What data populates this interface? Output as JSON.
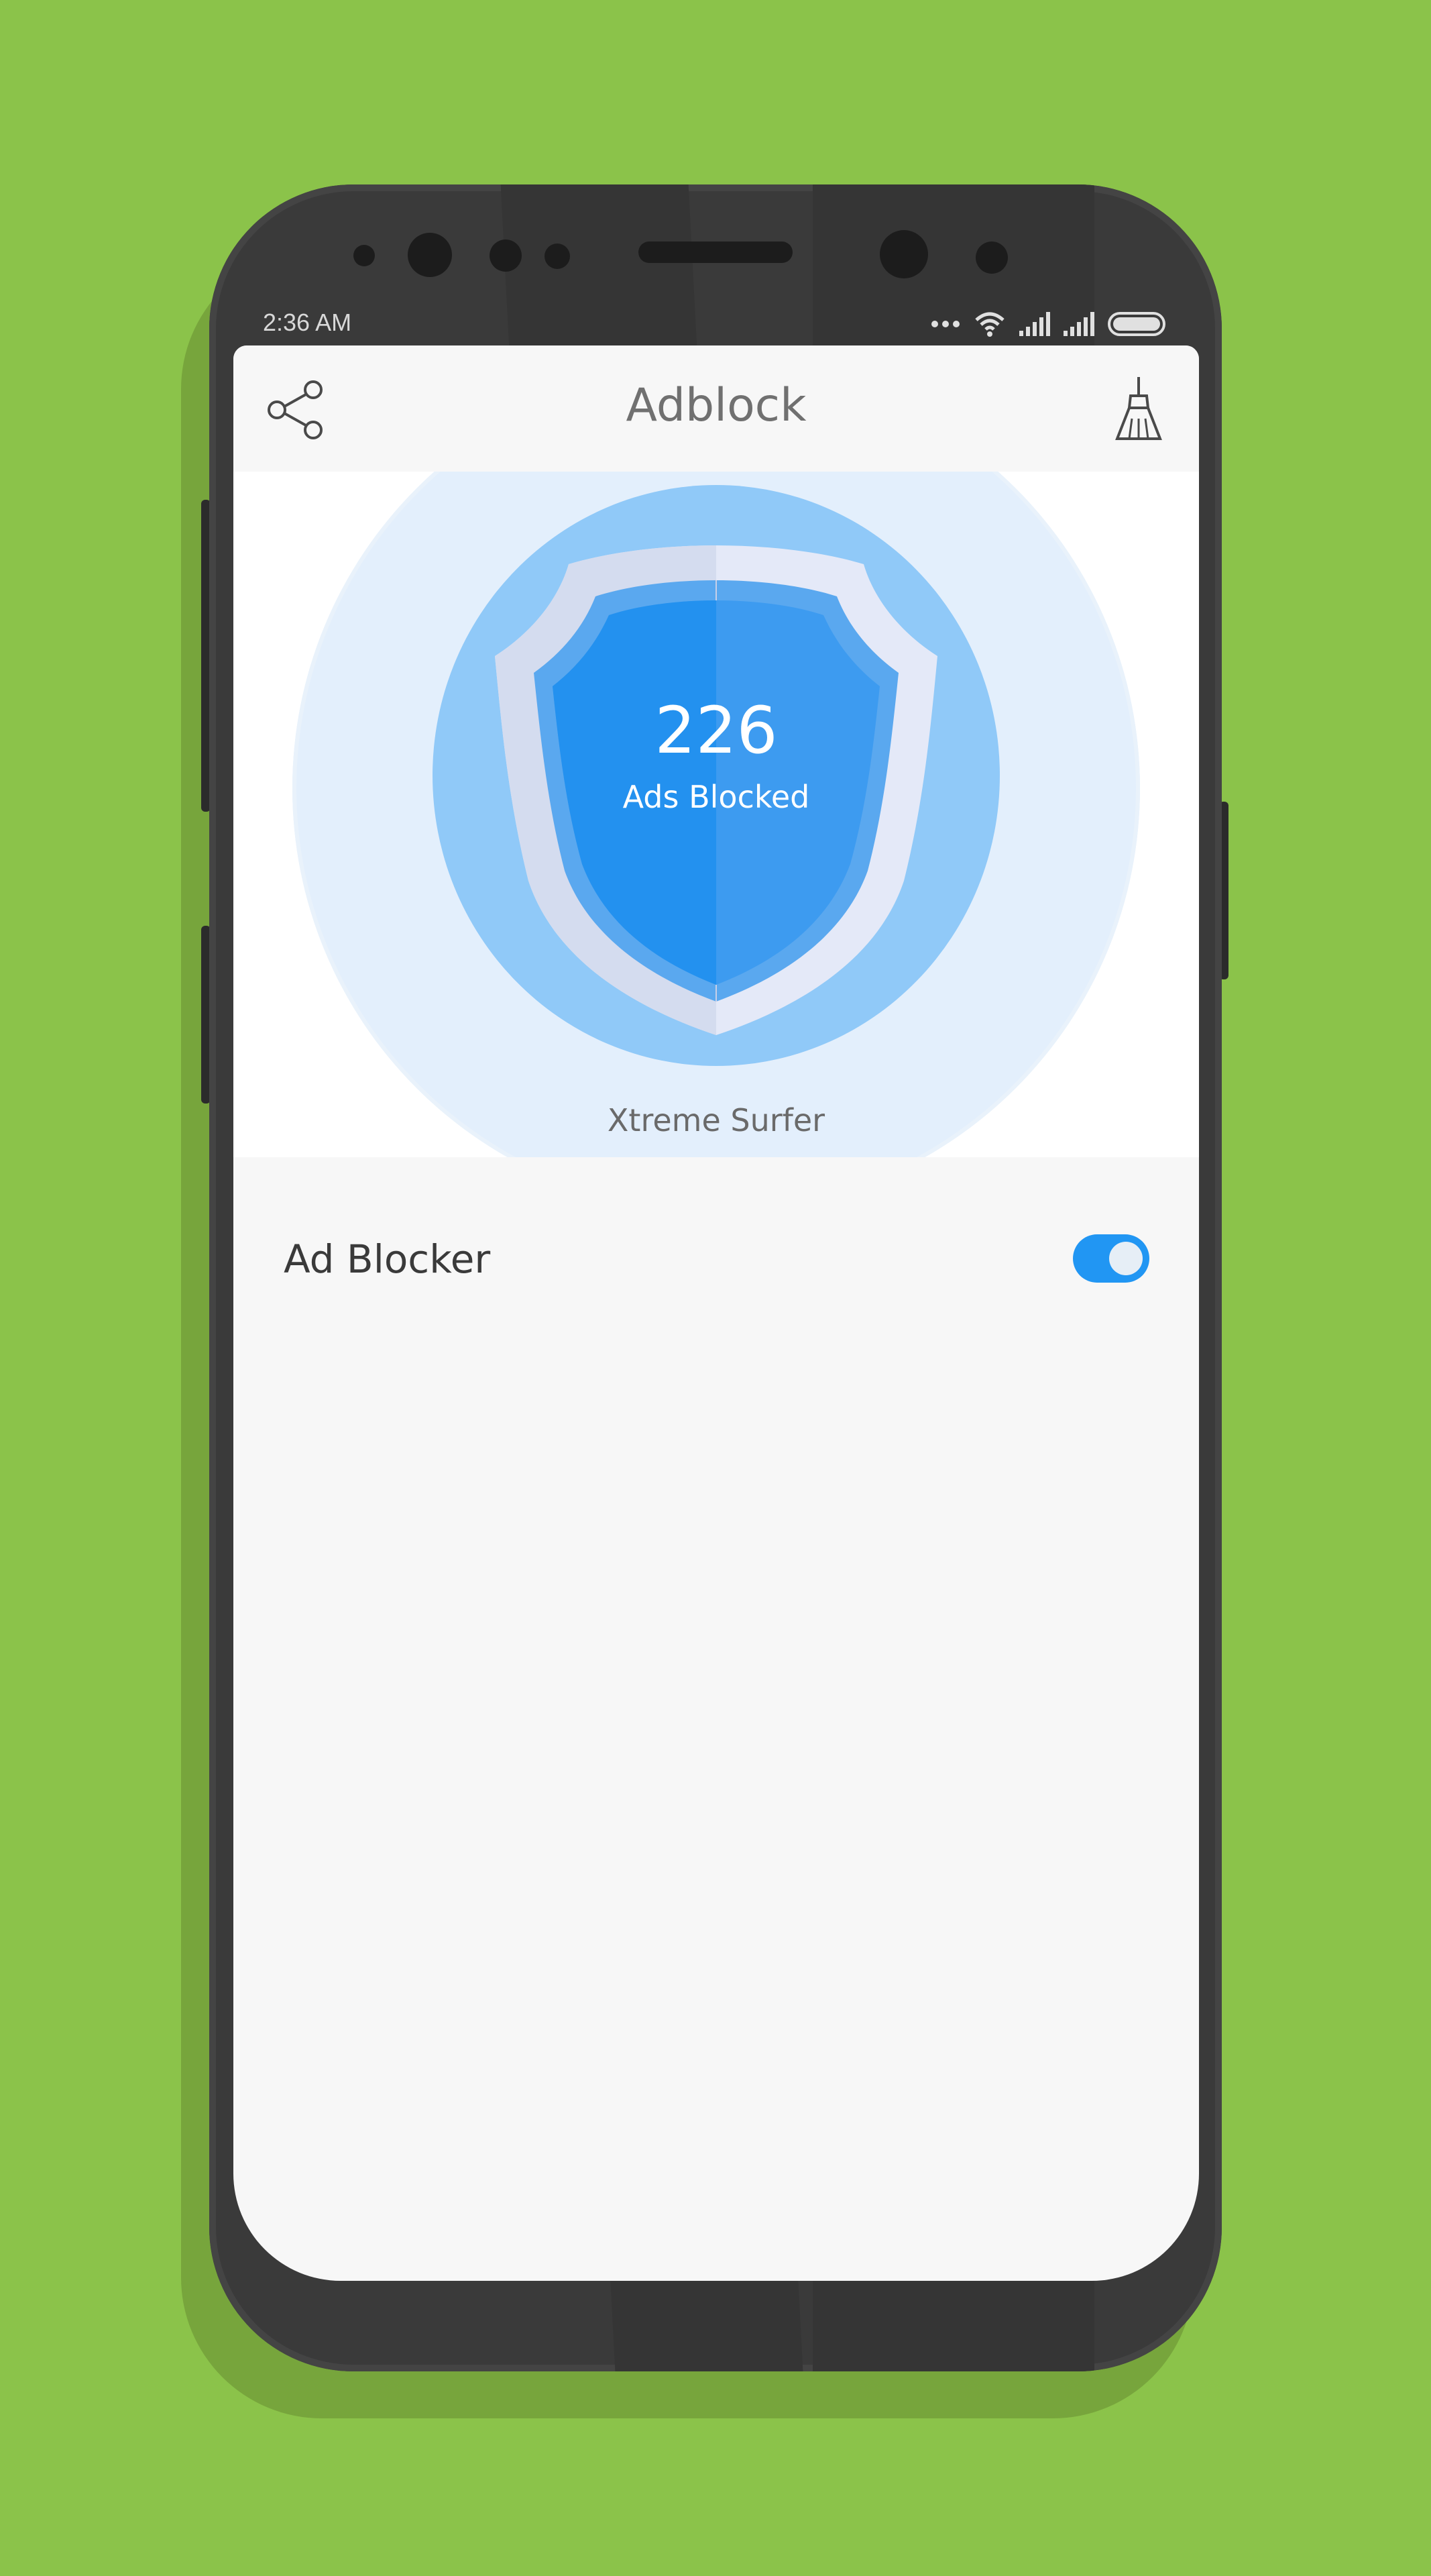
{
  "status_bar": {
    "time": "2:36 AM",
    "icons": [
      "more-dots-icon",
      "wifi-icon",
      "signal-icon",
      "signal-icon",
      "battery-icon"
    ]
  },
  "app_bar": {
    "title": "Adblock",
    "share_icon": "share-icon",
    "clean_icon": "broom-icon"
  },
  "hero": {
    "count": "226",
    "count_label": "Ads Blocked",
    "app_name": "Xtreme Surfer"
  },
  "settings": [
    {
      "label": "Ad Blocker",
      "enabled": true
    }
  ],
  "colors": {
    "background": "#8bc34a",
    "accent": "#2196f3",
    "light_circle": "#e3effc",
    "mid_circle": "#90c9f8"
  }
}
